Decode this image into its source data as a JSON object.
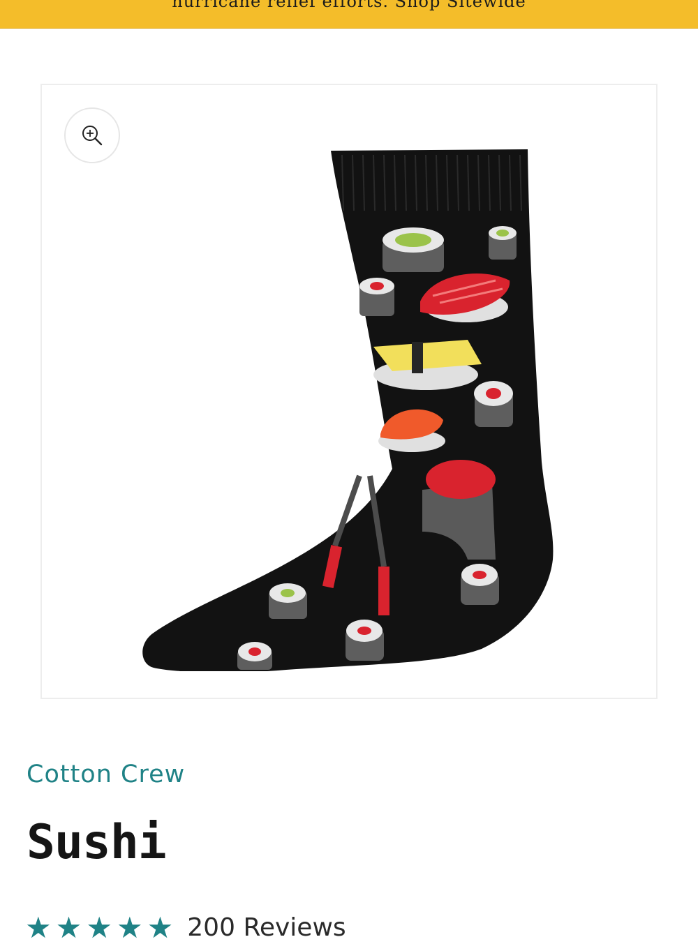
{
  "banner": {
    "text": "hurricane relief efforts. Shop Sitewide"
  },
  "gallery": {
    "zoom_icon": "zoom-in-icon",
    "product_image_alt": "Sushi sock"
  },
  "product": {
    "collection": "Cotton Crew",
    "title": "Sushi",
    "rating_stars": 5,
    "reviews_label": "200 Reviews"
  },
  "colors": {
    "banner_bg": "#f4bd2a",
    "accent_teal": "#1f8286",
    "sock_black": "#121212"
  }
}
